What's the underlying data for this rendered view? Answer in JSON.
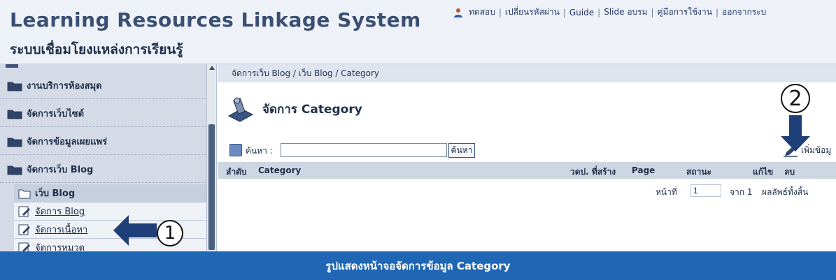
{
  "header": {
    "title": "Learning Resources Linkage System",
    "subtitle": "ระบบเชื่อมโยงแหล่งการเรียนรู้",
    "user_name": "ทดสอบ",
    "nav": [
      "เปลี่ยนรหัสผ่าน",
      "Guide",
      "Slide อบรม",
      "คู่มือการใช้งาน",
      "ออกจากระบ"
    ]
  },
  "sidebar": {
    "items": [
      "งานบริการห้องสมุด",
      "จัดการเว็บไซต์",
      "จัดการข้อมูลเผยแพร่",
      "จัดการเว็บ Blog"
    ],
    "subitems": [
      "เว็บ Blog",
      "จัดการ Blog",
      "จัดการเนื้อหา",
      "จัดการหมวด"
    ]
  },
  "main": {
    "breadcrumb": "จัดการเว็บ Blog / เว็บ Blog / Category",
    "page_title": "จัดการ Category",
    "search": {
      "label": "ค้นหา :",
      "value": "",
      "button": "ค้นหา"
    },
    "add_link": "เพิ่มข้อมู",
    "table_headers": {
      "order": "ลำดับ",
      "category": "Category",
      "created_date": "วดป. ที่สร้าง",
      "page": "Page",
      "status": "สถานะ",
      "edit": "แก้ไข",
      "delete": "ลบ"
    },
    "pager": {
      "page_label": "หน้าที่",
      "page_value": "1",
      "of_label": "จาก 1",
      "total_label": "ผลลัพธ์ทั้งสิ้น"
    }
  },
  "annotations": {
    "step1": "1",
    "step2": "2",
    "arrow_color": "#1e3f78"
  },
  "caption": "รูปแสดงหน้าจอจัดการข้อมูล Category",
  "colors": {
    "header_bg": "#eef2f8",
    "sidebar_bg": "#d4dbe6",
    "table_header_bg": "#cdd6e3",
    "caption_bg": "#1f66b5"
  }
}
